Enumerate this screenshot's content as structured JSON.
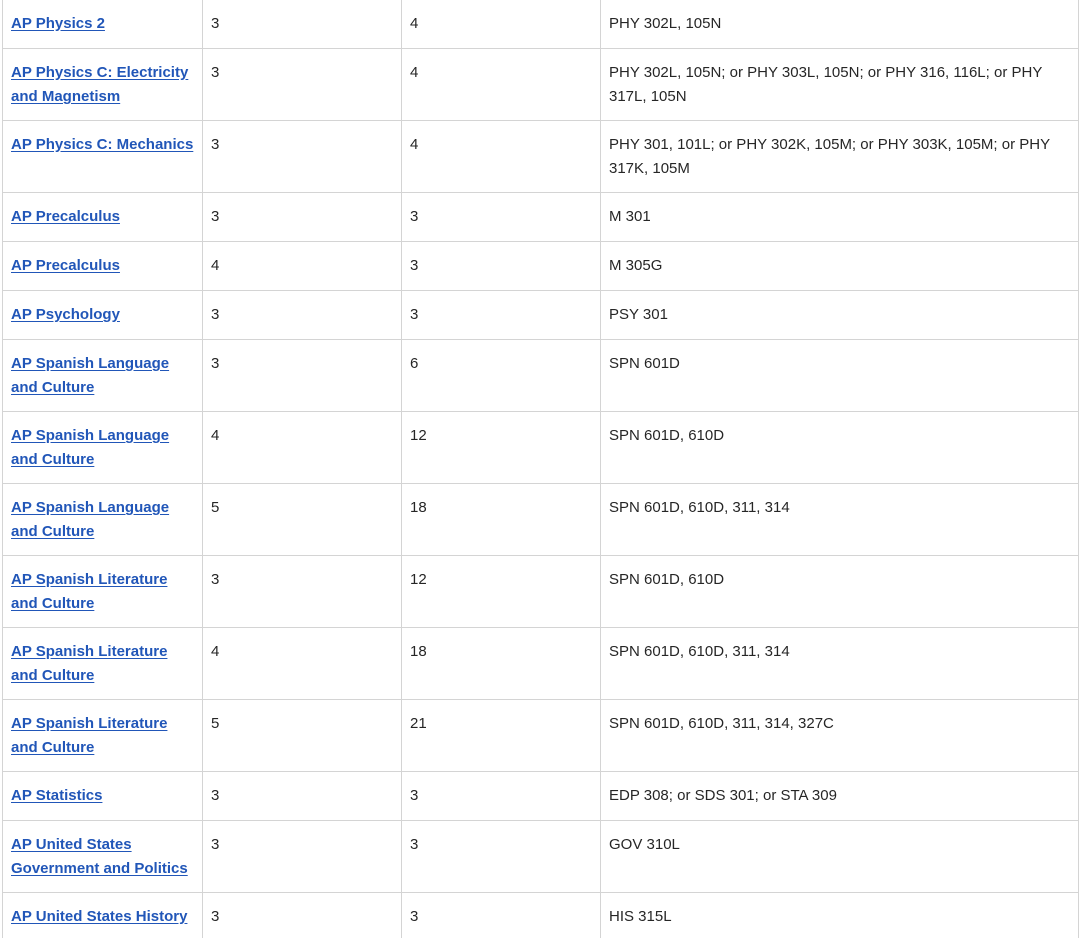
{
  "table": {
    "rows": [
      {
        "exam": "AP Physics 2",
        "score": "3",
        "hours": "4",
        "courses": "PHY 302L, 105N"
      },
      {
        "exam": "AP Physics C: Electricity and Magnetism",
        "score": "3",
        "hours": "4",
        "courses": "PHY 302L, 105N; or PHY 303L, 105N; or PHY 316, 116L; or PHY 317L, 105N"
      },
      {
        "exam": "AP Physics C: Mechanics",
        "score": "3",
        "hours": "4",
        "courses": "PHY 301, 101L; or PHY 302K, 105M; or PHY 303K, 105M; or PHY 317K, 105M"
      },
      {
        "exam": "AP Precalculus",
        "score": "3",
        "hours": "3",
        "courses": "M 301"
      },
      {
        "exam": "AP Precalculus",
        "score": "4",
        "hours": "3",
        "courses": "M 305G"
      },
      {
        "exam": "AP Psychology",
        "score": "3",
        "hours": "3",
        "courses": "PSY 301"
      },
      {
        "exam": "AP Spanish Language and Culture",
        "score": "3",
        "hours": "6",
        "courses": "SPN 601D"
      },
      {
        "exam": "AP Spanish Language and Culture",
        "score": "4",
        "hours": "12",
        "courses": "SPN 601D, 610D"
      },
      {
        "exam": "AP Spanish Language and Culture",
        "score": "5",
        "hours": "18",
        "courses": "SPN 601D, 610D, 311, 314"
      },
      {
        "exam": "AP Spanish Literature and Culture",
        "score": "3",
        "hours": "12",
        "courses": "SPN 601D, 610D"
      },
      {
        "exam": "AP Spanish Literature and Culture",
        "score": "4",
        "hours": "18",
        "courses": "SPN 601D, 610D, 311, 314"
      },
      {
        "exam": "AP Spanish Literature and Culture",
        "score": "5",
        "hours": "21",
        "courses": "SPN 601D, 610D, 311, 314, 327C"
      },
      {
        "exam": "AP Statistics",
        "score": "3",
        "hours": "3",
        "courses": "EDP 308; or SDS 301; or STA 309"
      },
      {
        "exam": "AP United States Government and Politics",
        "score": "3",
        "hours": "3",
        "courses": "GOV 310L"
      },
      {
        "exam": "AP United States History",
        "score": "3",
        "hours": "3",
        "courses": "HIS 315L"
      }
    ]
  },
  "colors": {
    "link": "#2156b8",
    "text": "#262626",
    "border": "#d4d4d4",
    "background": "#ffffff"
  }
}
